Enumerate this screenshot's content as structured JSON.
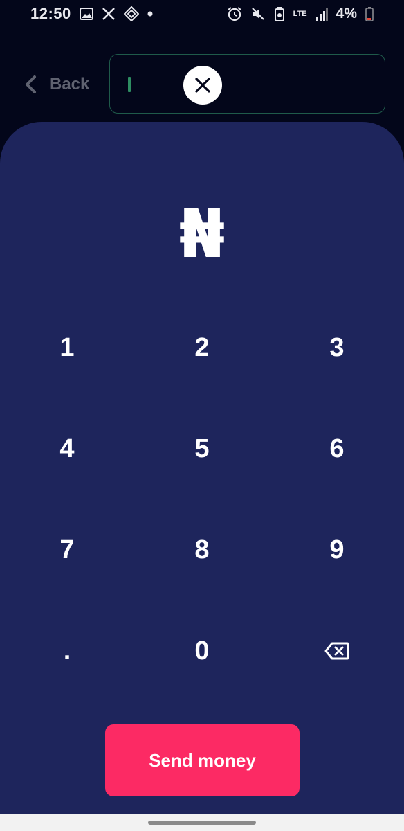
{
  "status_bar": {
    "time": "12:50",
    "left_icons": [
      "image-icon",
      "x-logo-icon",
      "app-diamond-icon",
      "dot-icon"
    ],
    "right_icons": [
      "alarm-icon",
      "mute-icon",
      "battery-saver-icon",
      "lte-icon",
      "signal-icon"
    ],
    "network": "LTE",
    "battery": "4%",
    "battery_color": "#e5483a"
  },
  "top_bar": {
    "back_label": "Back",
    "search_value": "",
    "accent_color": "#2e8d62"
  },
  "amount": {
    "currency_symbol": "₦"
  },
  "keypad": {
    "keys": [
      "1",
      "2",
      "3",
      "4",
      "5",
      "6",
      "7",
      "8",
      "9",
      ".",
      "0"
    ],
    "backspace_icon": "backspace-icon"
  },
  "actions": {
    "send_label": "Send money",
    "send_color": "#fc2a64"
  },
  "colors": {
    "background": "#03061a",
    "panel": "#1e255c"
  }
}
